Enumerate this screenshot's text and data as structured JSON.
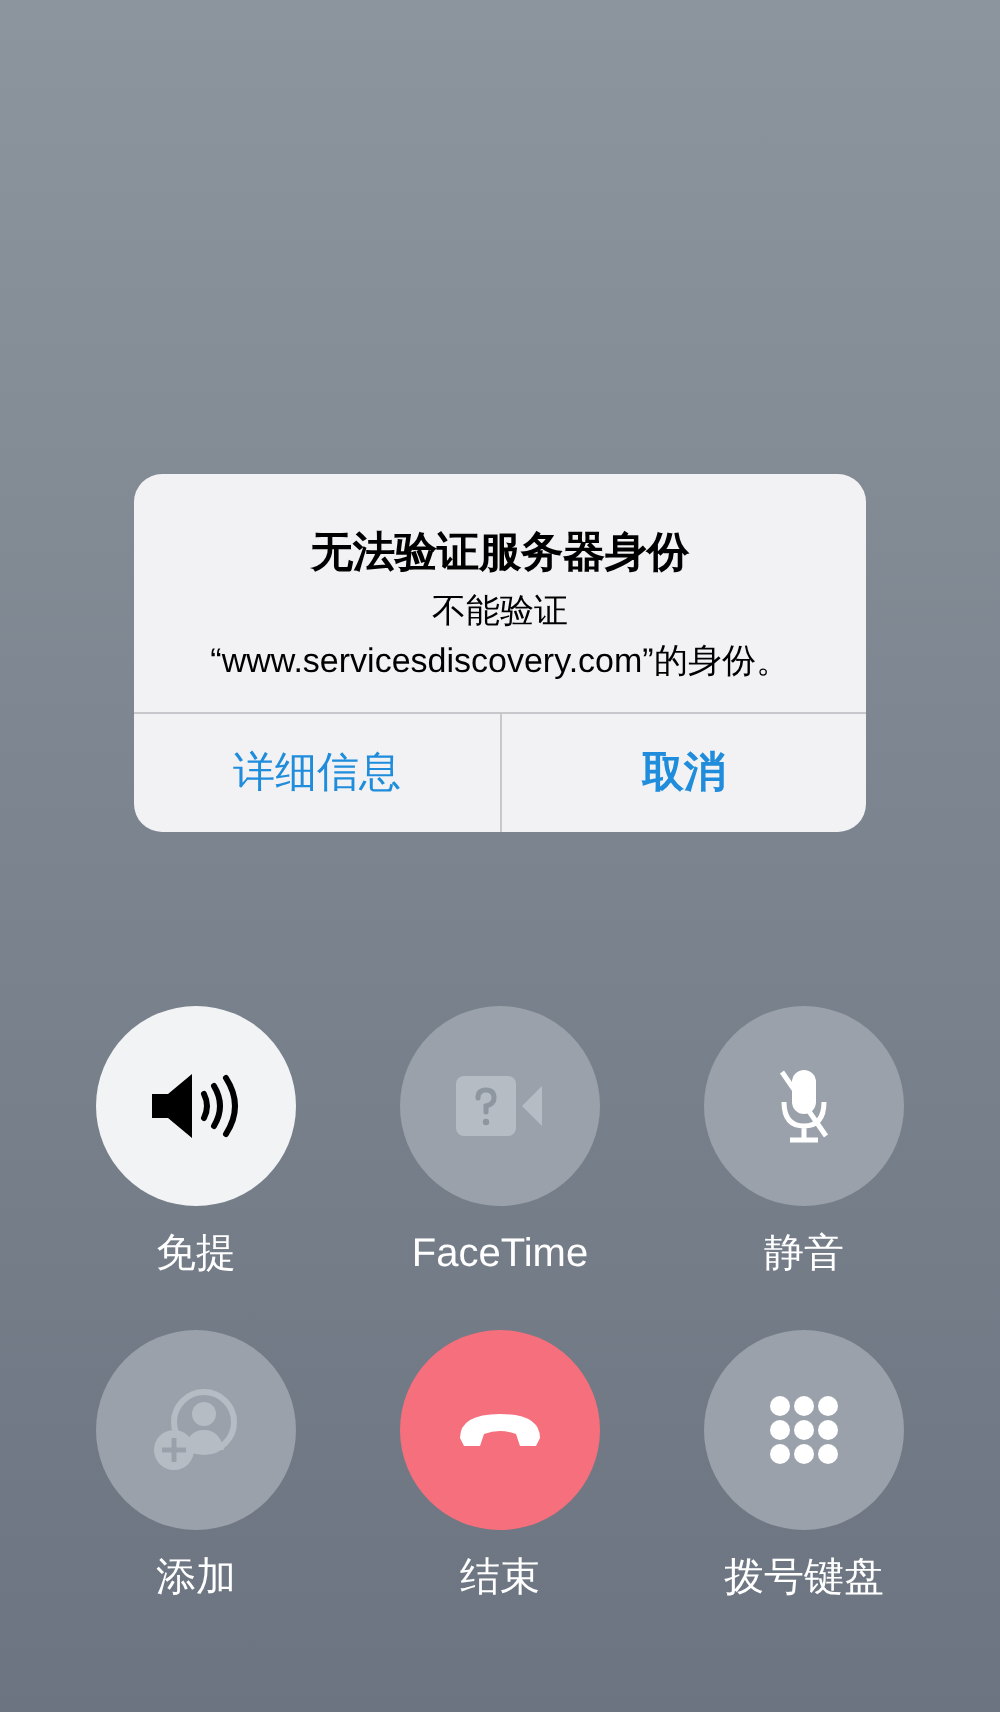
{
  "alert": {
    "title": "无法验证服务器身份",
    "message": "不能验证\n“www.servicesdiscovery.com”的身份。",
    "buttons": [
      {
        "label": "详细信息",
        "bold": false
      },
      {
        "label": "取消",
        "bold": true
      }
    ]
  },
  "call_controls": [
    {
      "kind": "speaker",
      "label": "免提",
      "active": true,
      "disabled": false
    },
    {
      "kind": "facetime",
      "label": "FaceTime",
      "active": false,
      "disabled": true
    },
    {
      "kind": "mute",
      "label": "静音",
      "active": false,
      "disabled": false
    },
    {
      "kind": "add",
      "label": "添加",
      "active": false,
      "disabled": true
    },
    {
      "kind": "end",
      "label": "结束"
    },
    {
      "kind": "keypad",
      "label": "拨号键盘",
      "active": false,
      "disabled": false
    }
  ]
}
